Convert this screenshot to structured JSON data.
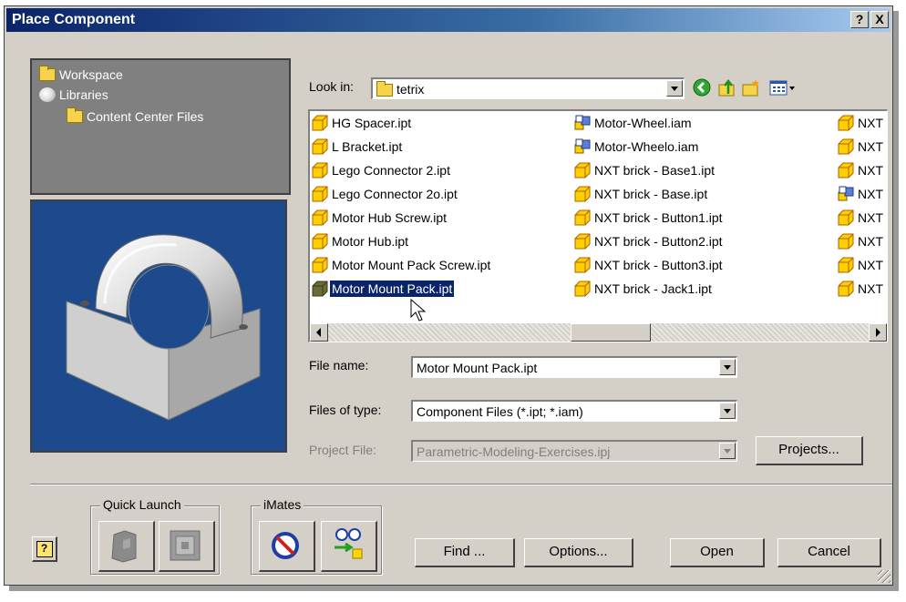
{
  "dialog": {
    "title": "Place Component",
    "help_button": "?",
    "close_button": "X"
  },
  "tree": {
    "items": [
      {
        "label": "Workspace",
        "icon": "folder-icon"
      },
      {
        "label": "Libraries",
        "icon": "library-icon"
      },
      {
        "label": "Content Center Files",
        "icon": "folder-icon"
      }
    ]
  },
  "lookin": {
    "label": "Look in:",
    "value": "tetrix",
    "tools": [
      "back-icon",
      "up-folder-icon",
      "new-folder-icon",
      "view-menu-icon"
    ]
  },
  "files": {
    "col1": [
      "HG Spacer.ipt",
      "L Bracket.ipt",
      "Lego Connector 2.ipt",
      "Lego Connector 2o.ipt",
      "Motor Hub Screw.ipt",
      "Motor Hub.ipt",
      "Motor Mount Pack Screw.ipt",
      "Motor Mount Pack.ipt"
    ],
    "col2": [
      "Motor-Wheel.iam",
      "Motor-Wheelo.iam",
      "NXT brick - Base1.ipt",
      "NXT brick - Base.ipt",
      "NXT brick - Button1.ipt",
      "NXT brick - Button2.ipt",
      "NXT brick - Button3.ipt",
      "NXT brick - Jack1.ipt"
    ],
    "col3": [
      "NXT",
      "NXT",
      "NXT",
      "NXT",
      "NXT",
      "NXT",
      "NXT",
      "NXT"
    ],
    "selected": "Motor Mount Pack.ipt"
  },
  "form": {
    "file_name_label": "File name:",
    "file_name_value": "Motor Mount Pack.ipt",
    "files_of_type_label": "Files of type:",
    "files_of_type_value": "Component Files (*.ipt; *.iam)",
    "project_file_label": "Project File:",
    "project_file_value": "Parametric-Modeling-Exercises.ipj",
    "projects_button": "Projects..."
  },
  "groups": {
    "quick_launch": "Quick Launch",
    "imates": "iMates"
  },
  "buttons": {
    "help": "?",
    "find": "Find ...",
    "options": "Options...",
    "open": "Open",
    "cancel": "Cancel"
  },
  "colors": {
    "title_bar": "#0a246a",
    "dialog_bg": "#d4d0c8",
    "selection": "#0a246a",
    "preview_bg": "#1d4a8c"
  }
}
